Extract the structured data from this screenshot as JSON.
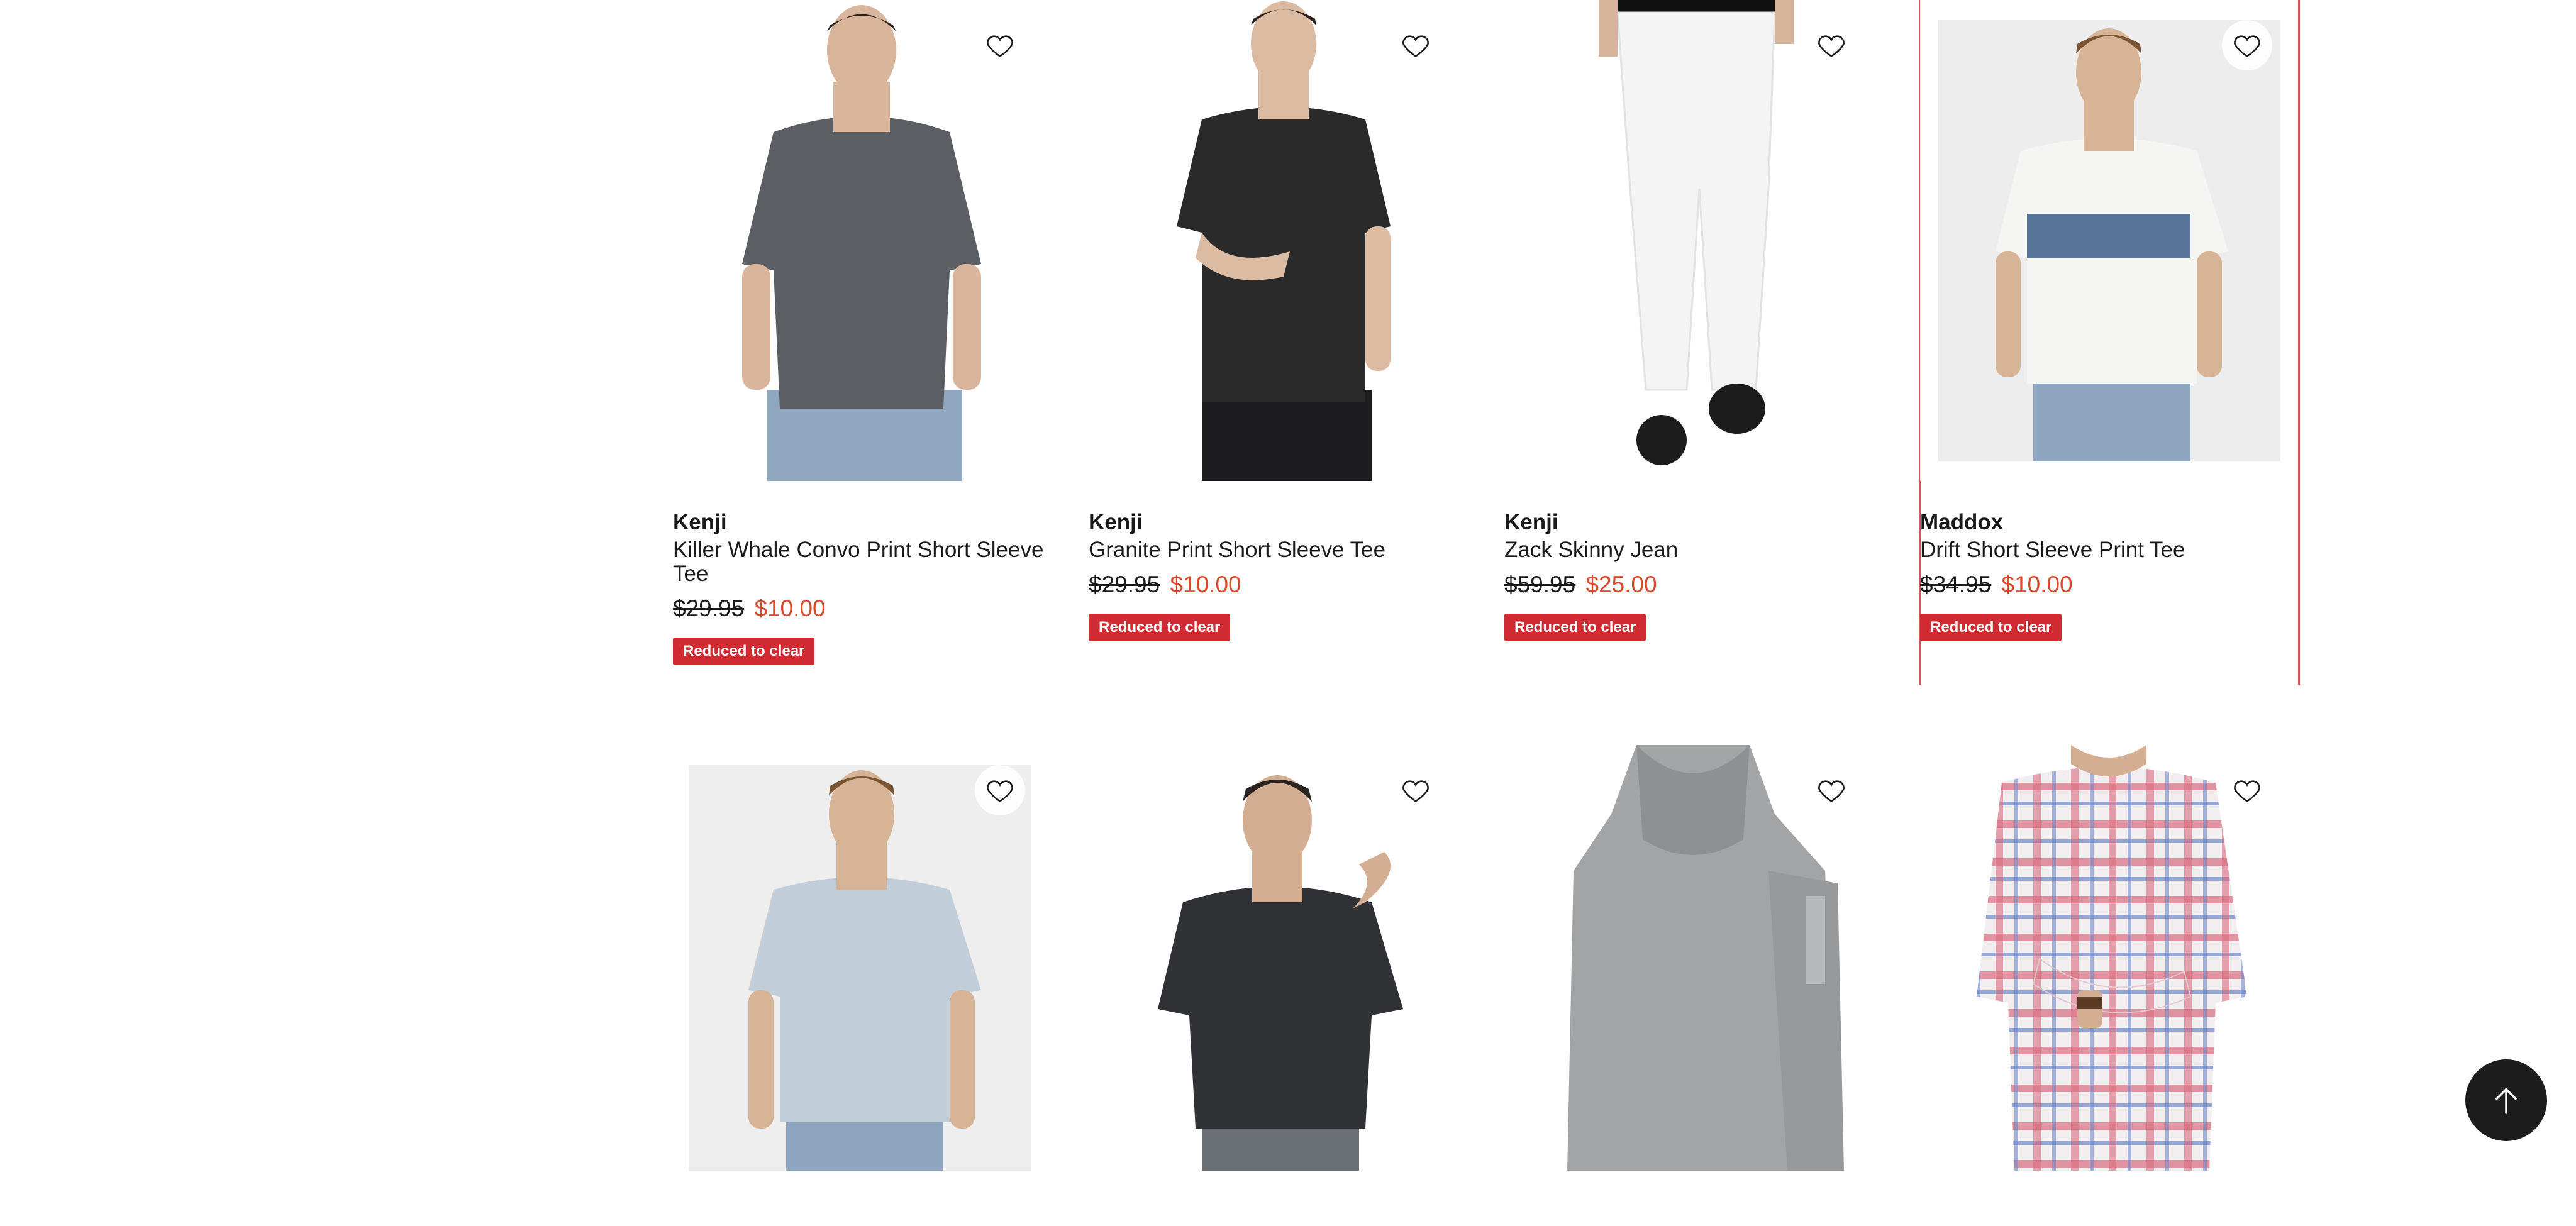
{
  "products": [
    {
      "brand": "Kenji",
      "title": "Killer Whale Convo Print Short Sleeve Tee",
      "was": "$29.95",
      "now": "$10.00",
      "badge": "Reduced to clear",
      "shirt": "#5b5f63",
      "bg": "#ffffff",
      "pants": "#8fa8bf"
    },
    {
      "brand": "Kenji",
      "title": "Granite Print Short Sleeve Tee",
      "was": "$29.95",
      "now": "$10.00",
      "badge": "Reduced to clear",
      "shirt": "#2b2a2b",
      "bg": "#ffffff",
      "pants": "#1d1d1f"
    },
    {
      "brand": "Kenji",
      "title": "Zack Skinny Jean",
      "was": "$59.95",
      "now": "$25.00",
      "badge": "Reduced to clear",
      "shirt": "#111111",
      "bg": "#ffffff",
      "pants": "#f4f4f4"
    },
    {
      "brand": "Maddox",
      "title": "Drift Short Sleeve Print Tee",
      "was": "$34.95",
      "now": "$10.00",
      "badge": "Reduced to clear",
      "shirt": "#f5f5f3",
      "bg": "#ededed",
      "pants": "#8ea6c0"
    },
    {
      "shirt": "#c3cedb",
      "bg": "#eeeeee",
      "pants": "#8ea6c0"
    },
    {
      "shirt": "#303236",
      "bg": "#ffffff",
      "pants": "#6b6f76"
    },
    {
      "shirt": "#a3a4a6",
      "bg": "#ffffff",
      "pants": "#9a9a9a"
    },
    {
      "shirt": "#d96d7e",
      "bg": "#ffffff",
      "pants": "#e9e0d0"
    }
  ],
  "colors": {
    "accent": "#d02b33",
    "sale": "#d9482b"
  },
  "icons": {
    "wishlist": "heart-outline-icon",
    "back_to_top": "arrow-up-icon"
  }
}
